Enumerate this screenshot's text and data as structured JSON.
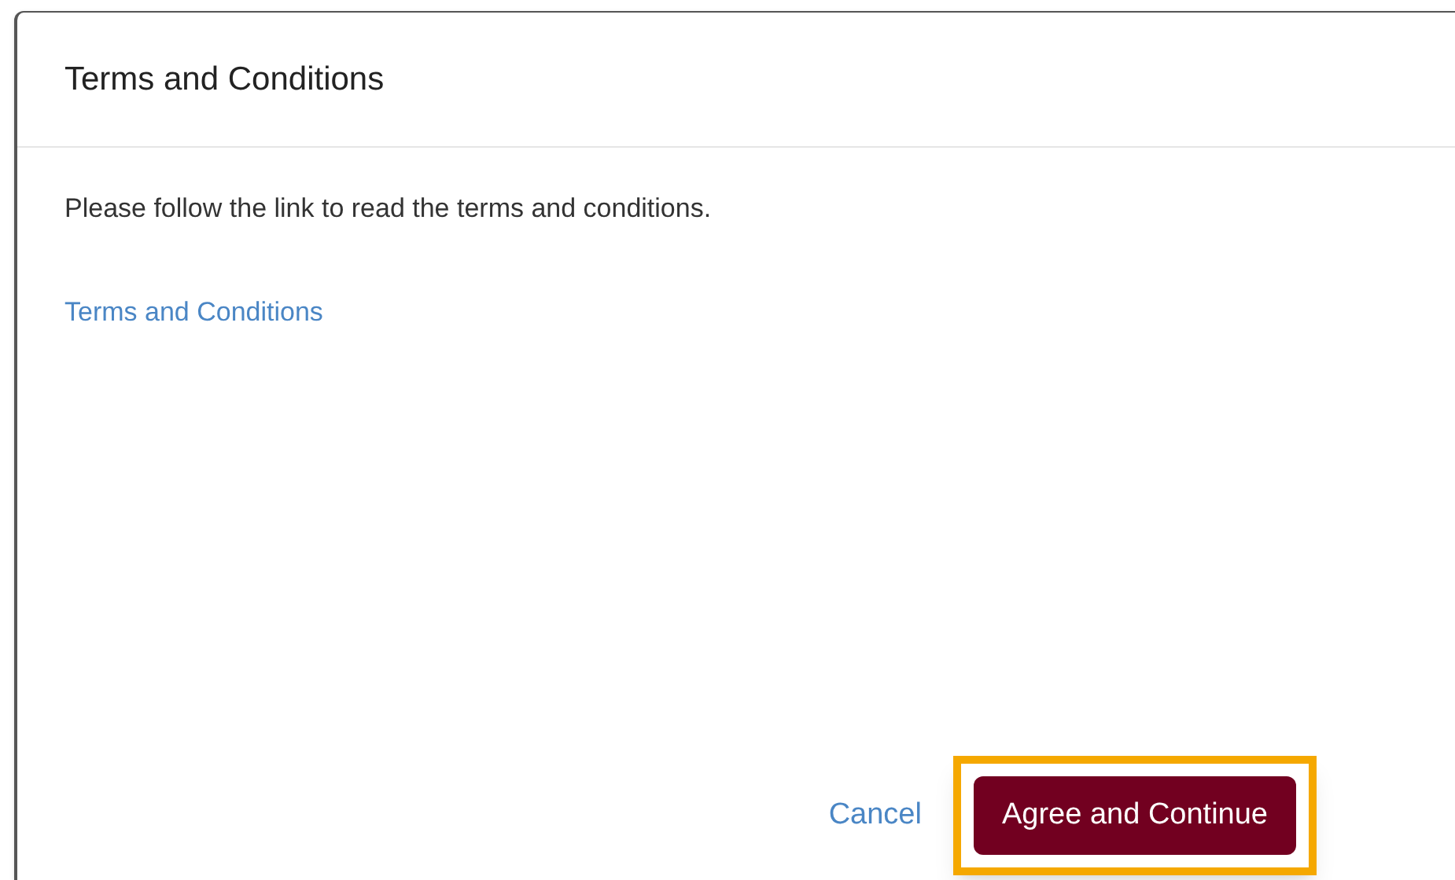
{
  "dialog": {
    "title": "Terms and Conditions",
    "message": "Please follow the link to read the terms and conditions.",
    "link": "Terms and Conditions",
    "buttons": [
      {
        "label": "Cancel",
        "kind": "link",
        "highlighted": false
      },
      {
        "label": "Agree and Continue",
        "kind": "primary",
        "highlighted": true
      }
    ]
  }
}
